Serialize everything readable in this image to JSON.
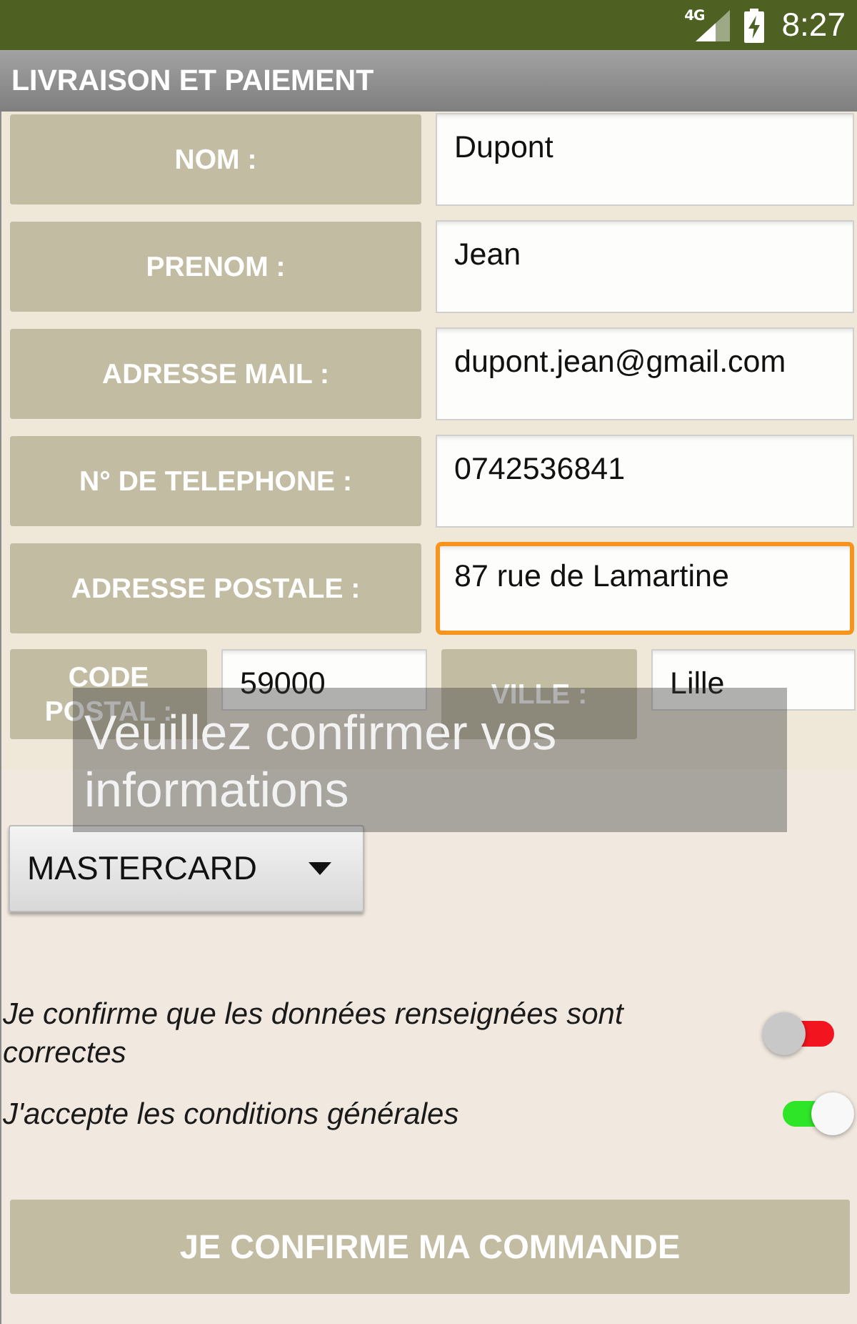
{
  "status_bar": {
    "network": "4G",
    "time": "8:27"
  },
  "app_bar": {
    "title": "LIVRAISON ET PAIEMENT"
  },
  "form": {
    "rows": [
      {
        "fields": [
          {
            "label": "NOM :",
            "value": "Dupont",
            "focused": false
          }
        ]
      },
      {
        "fields": [
          {
            "label": "PRENOM :",
            "value": "Jean",
            "focused": false
          }
        ]
      },
      {
        "fields": [
          {
            "label": "ADRESSE MAIL :",
            "value": "dupont.jean@gmail.com",
            "focused": false
          }
        ]
      },
      {
        "fields": [
          {
            "label": "N° DE TELEPHONE :",
            "value": "0742536841",
            "focused": false
          }
        ]
      },
      {
        "fields": [
          {
            "label": "ADRESSE POSTALE :",
            "value": "87 rue de Lamartine",
            "focused": true
          }
        ]
      },
      {
        "fields": [
          {
            "label": "CODE POSTAL :",
            "value": "59000",
            "focused": false
          },
          {
            "label": "VILLE :",
            "value": "Lille",
            "focused": false
          }
        ]
      }
    ]
  },
  "payment_dropdown": {
    "value": "MASTERCARD"
  },
  "switches": [
    {
      "label": "Je confirme que les données renseignées sont correctes",
      "on": false
    },
    {
      "label": "J'accepte les conditions générales",
      "on": true
    }
  ],
  "confirm_button": {
    "label": "JE CONFIRME MA COMMANDE"
  },
  "toast": {
    "text": "Veuillez confirmer vos informations"
  }
}
